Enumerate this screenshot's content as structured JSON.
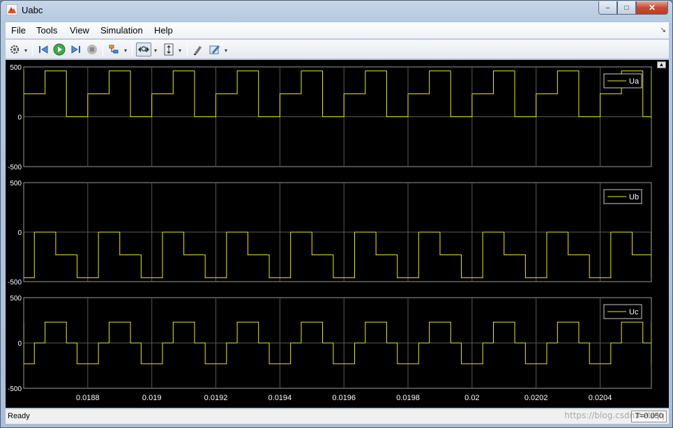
{
  "window": {
    "title": "Uabc",
    "minimize": "–",
    "maximize": "□",
    "close": "✕"
  },
  "menu": {
    "items": [
      "File",
      "Tools",
      "View",
      "Simulation",
      "Help"
    ],
    "overflow_icon": "chevron-icon"
  },
  "toolbar": {
    "icons": [
      "gear-icon",
      "step-back-icon",
      "run-icon",
      "step-forward-icon",
      "stop-icon",
      "highlight-icon",
      "zoom-x-icon",
      "zoom-y-icon",
      "style-icon",
      "measure-icon"
    ]
  },
  "status": {
    "text": "Ready",
    "time": "T=0.050"
  },
  "watermark": "https://blog.csdn.net/qq",
  "colors": {
    "trace": "#e8e82a",
    "grid": "#5a5a5a",
    "axes_text": "#ffffff",
    "plot_bg": "#000000"
  },
  "chart_data": [
    {
      "type": "line",
      "name": "Ua",
      "ylim": [
        -500,
        500
      ],
      "yticks": [
        "500",
        "0",
        "-500"
      ],
      "xlim": [
        0.0186,
        0.02056
      ],
      "legend": "Ua",
      "legend_position": "top-right",
      "period": 0.0002,
      "phase_offset": 0.0,
      "levels": {
        "high": 460,
        "mid": 230,
        "zero": 0
      }
    },
    {
      "type": "line",
      "name": "Ub",
      "ylim": [
        -500,
        500
      ],
      "yticks": [
        "500",
        "0",
        "-500"
      ],
      "xlim": [
        0.0186,
        0.02056
      ],
      "legend": "Ub",
      "legend_position": "top-right",
      "period": 0.0002,
      "phase_offset": 6.67e-05,
      "levels": {
        "low": -460,
        "mid": -230,
        "zero": 0,
        "spike": 230
      }
    },
    {
      "type": "line",
      "name": "Uc",
      "ylim": [
        -500,
        500
      ],
      "yticks": [
        "500",
        "0",
        "-500"
      ],
      "xlim": [
        0.0186,
        0.02056
      ],
      "legend": "Uc",
      "legend_position": "top-right",
      "period": 0.0002,
      "phase_offset": 0.0001333,
      "levels": {
        "high": 230,
        "low": -230,
        "zero": 0,
        "spike_low": -460,
        "spike_high": 230
      }
    }
  ],
  "x_axis": {
    "ticks": [
      0.0188,
      0.019,
      0.0192,
      0.0194,
      0.0196,
      0.0198,
      0.02,
      0.0202,
      0.0204
    ],
    "labels": [
      "0.0188",
      "0.019",
      "0.0192",
      "0.0194",
      "0.0196",
      "0.0198",
      "0.02",
      "0.0202",
      "0.0204"
    ]
  }
}
